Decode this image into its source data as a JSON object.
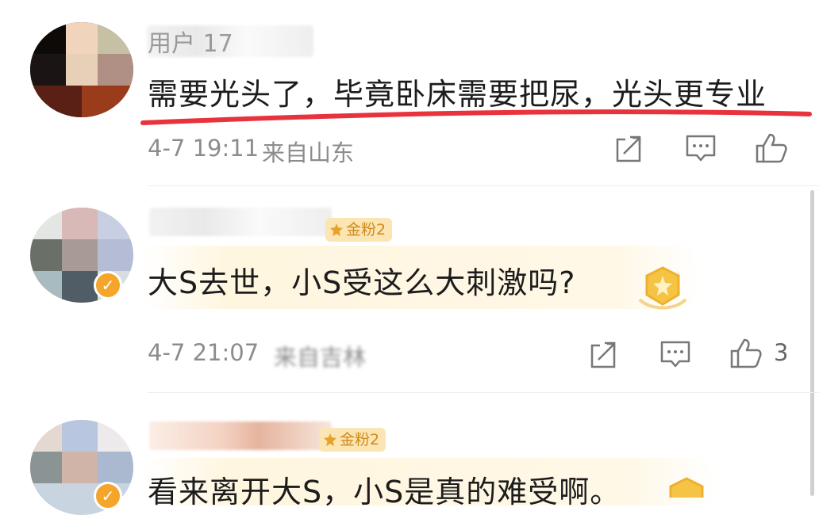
{
  "comments": [
    {
      "username": "用户        17",
      "text": "需要光头了，毕竟卧床需要把尿，光头更专业",
      "time": "4-7 19:11",
      "location": "来自山东",
      "likes": "",
      "badge": ""
    },
    {
      "username": "",
      "text": "大S去世，小S受这么大刺激吗?",
      "time": "4-7 21:07",
      "location": "来自吉林",
      "likes": "3",
      "badge": "金粉2"
    },
    {
      "username": "",
      "text": "看来离开大S，小S是真的难受啊。",
      "time": "",
      "location": "",
      "likes": "",
      "badge": "金粉2"
    }
  ],
  "colors": {
    "underline": "#e8323c",
    "badge_bg": "#fbe5b2",
    "badge_text": "#d08a1c",
    "meta_text": "#8c8c8c",
    "icon_stroke": "#777777"
  },
  "icons": [
    "share-icon",
    "comment-icon",
    "like-icon",
    "verified-icon",
    "gold-badge-icon"
  ]
}
